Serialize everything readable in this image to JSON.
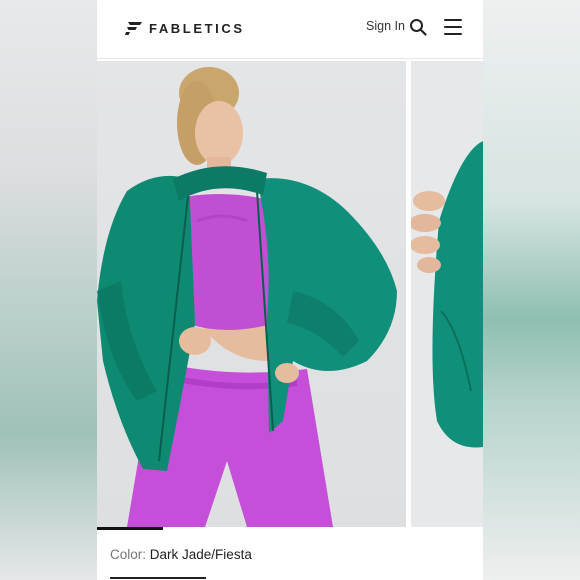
{
  "header": {
    "brand": "FABLETICS",
    "signin_label": "Sign In"
  },
  "gallery": {
    "images": [
      {
        "alt": "Model wearing dark jade windbreaker jacket over fiesta pink crop top and leggings"
      },
      {
        "alt": "Close-up of jacket sleeve and hand"
      }
    ],
    "progress": 0.17
  },
  "product": {
    "color_label": "Color:",
    "color_value": "Dark Jade/Fiesta"
  },
  "colors": {
    "jade": "#0f8a72",
    "fiesta": "#c74ad6",
    "brand_text": "#222222"
  }
}
